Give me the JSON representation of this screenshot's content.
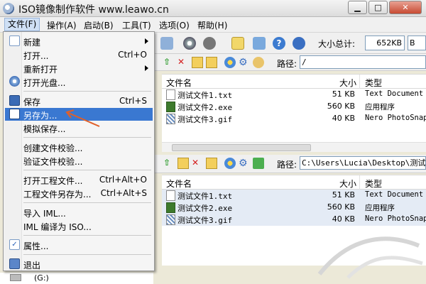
{
  "window": {
    "title": "ISO镜像制作软件 www.leawo.cn",
    "controls": [
      "minimize",
      "maximize",
      "close"
    ]
  },
  "menubar": [
    {
      "label": "文件(F)"
    },
    {
      "label": "操作(A)"
    },
    {
      "label": "启动(B)"
    },
    {
      "label": "工具(T)"
    },
    {
      "label": "选项(O)"
    },
    {
      "label": "帮助(H)"
    }
  ],
  "toolbar": {
    "total_label": "大小总计:",
    "total_value": "652KB",
    "unit_value": "B"
  },
  "file_menu": [
    {
      "label": "新建",
      "shortcut": "",
      "submenu": true,
      "icon": "new-file-icon"
    },
    {
      "label": "打开...",
      "shortcut": "Ctrl+O",
      "submenu": false,
      "icon": ""
    },
    {
      "label": "重新打开",
      "shortcut": "",
      "submenu": true,
      "icon": ""
    },
    {
      "label": "打开光盘...",
      "shortcut": "",
      "submenu": false,
      "icon": "cd-icon"
    },
    {
      "label": "保存",
      "shortcut": "Ctrl+S",
      "submenu": false,
      "icon": "save-icon"
    },
    {
      "label": "另存为...",
      "shortcut": "",
      "submenu": false,
      "icon": "save-as-icon",
      "highlighted": true
    },
    {
      "label": "模拟保存...",
      "shortcut": "",
      "submenu": false,
      "icon": ""
    },
    {
      "label": "创建文件校验...",
      "shortcut": "",
      "submenu": false,
      "icon": ""
    },
    {
      "label": "验证文件校验...",
      "shortcut": "",
      "submenu": false,
      "icon": ""
    },
    {
      "label": "打开工程文件...",
      "shortcut": "Ctrl+Alt+O",
      "submenu": false,
      "icon": ""
    },
    {
      "label": "工程文件另存为...",
      "shortcut": "Ctrl+Alt+S",
      "submenu": false,
      "icon": ""
    },
    {
      "label": "导入 IML...",
      "shortcut": "",
      "submenu": false,
      "icon": ""
    },
    {
      "label": "IML 编译为 ISO...",
      "shortcut": "",
      "submenu": false,
      "icon": ""
    },
    {
      "label": "属性...",
      "shortcut": "",
      "submenu": false,
      "icon": "properties-icon"
    },
    {
      "label": "退出",
      "shortcut": "",
      "submenu": false,
      "icon": "exit-icon"
    }
  ],
  "top_pane": {
    "path_label": "路径:",
    "path_value": "/",
    "columns": [
      "文件名",
      "大小",
      "类型"
    ],
    "rows": [
      {
        "name": "测试文件1.txt",
        "size": "51 KB",
        "type": "Text Document"
      },
      {
        "name": "测试文件2.exe",
        "size": "560 KB",
        "type": "应用程序"
      },
      {
        "name": "测试文件3.gif",
        "size": "40 KB",
        "type": "Nero PhotoSnap"
      }
    ]
  },
  "bottom_pane": {
    "path_label": "路径:",
    "path_value": "C:\\Users\\Lucia\\Desktop\\测试",
    "columns": [
      "文件名",
      "大小",
      "类型"
    ],
    "rows": [
      {
        "name": "测试文件1.txt",
        "size": "51 KB",
        "type": "Text Document"
      },
      {
        "name": "测试文件2.exe",
        "size": "560 KB",
        "type": "应用程序"
      },
      {
        "name": "测试文件3.gif",
        "size": "40 KB",
        "type": "Nero PhotoSnap"
      }
    ]
  },
  "tree": {
    "drive_label": "(G:)"
  },
  "colors": {
    "highlight": "#3a78d1",
    "arrow": "#e0602a"
  }
}
